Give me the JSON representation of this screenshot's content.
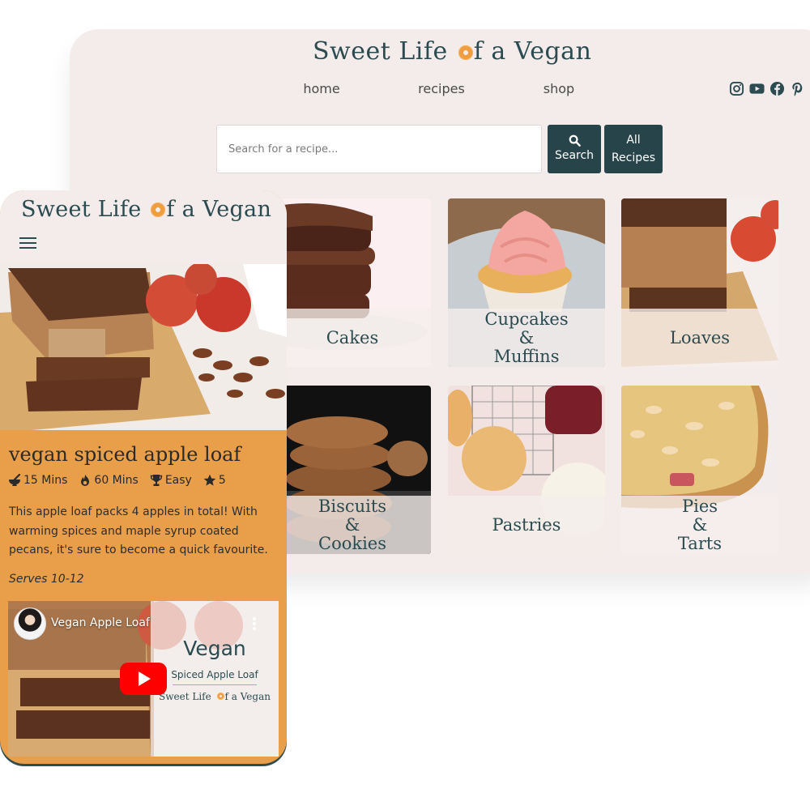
{
  "colors": {
    "brand_dark": "#26444a",
    "accent_orange": "#e99e4a",
    "page_bg": "#f3eceb",
    "youtube_red": "#ff0000"
  },
  "desktop": {
    "logo": {
      "before": "Sweet Life ",
      "after": "f a Vegan",
      "icon": "orange-flower-icon"
    },
    "nav": [
      {
        "label": "home"
      },
      {
        "label": "recipes"
      },
      {
        "label": "shop"
      }
    ],
    "social": [
      {
        "icon": "instagram-icon"
      },
      {
        "icon": "youtube-icon"
      },
      {
        "icon": "facebook-icon"
      },
      {
        "icon": "pinterest-icon"
      }
    ],
    "search": {
      "placeholder": "Search for a recipe...",
      "value": "",
      "search_button": {
        "icon": "magnifier-icon",
        "label": "Search"
      },
      "all_button": {
        "line1": "All",
        "line2": "Recipes"
      }
    },
    "categories": [
      {
        "lines": [
          "Cakes"
        ]
      },
      {
        "lines": [
          "Cupcakes",
          "&",
          "Muffins"
        ]
      },
      {
        "lines": [
          "Loaves"
        ]
      },
      {
        "lines": [
          "Biscuits",
          "&",
          "Cookies"
        ]
      },
      {
        "lines": [
          "Pastries"
        ]
      },
      {
        "lines": [
          "Pies",
          "&",
          "Tarts"
        ]
      }
    ]
  },
  "mobile": {
    "logo": {
      "before": "Sweet Life ",
      "after": "f a Vegan"
    },
    "menu_icon": "hamburger-icon",
    "recipe": {
      "title": "vegan spiced apple loaf",
      "meta": [
        {
          "icon": "mortar-pestle-icon",
          "text": "15 Mins"
        },
        {
          "icon": "fire-icon",
          "text": "60 Mins"
        },
        {
          "icon": "trophy-icon",
          "text": "Easy"
        },
        {
          "icon": "star-icon",
          "text": "5"
        }
      ],
      "description": "This apple loaf packs 4 apples in total! With warming spices and maple syrup coated pecans, it's sure to become a quick favourite.",
      "serves": "Serves 10-12"
    },
    "video": {
      "title": "Vegan Apple Loaf",
      "overlay_big": "Vegan",
      "overlay_sub": "Spiced Apple Loaf",
      "overlay_brand_before": "Sweet Life ",
      "overlay_brand_after": "f a Vegan"
    }
  }
}
